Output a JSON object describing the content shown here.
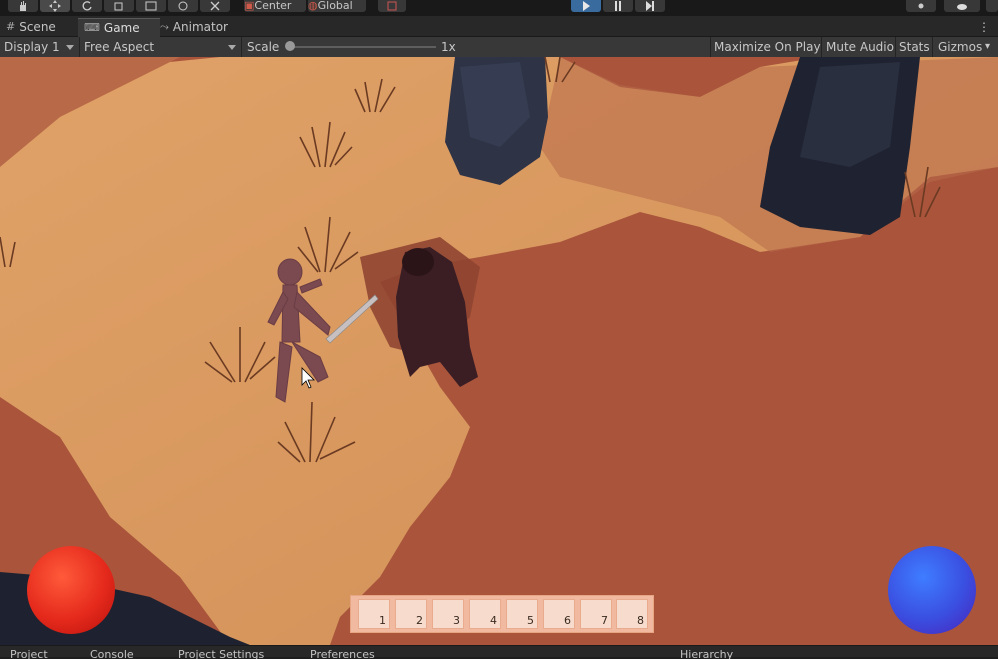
{
  "toolbar": {
    "pivot_label": "Center",
    "space_label": "Global"
  },
  "tabs": [
    {
      "label": "Scene",
      "icon": "grid-icon"
    },
    {
      "label": "Game",
      "icon": "gamepad-icon"
    },
    {
      "label": "Animator",
      "icon": "animator-icon"
    }
  ],
  "game_toolbar": {
    "display": "Display 1",
    "aspect": "Free Aspect",
    "scale_label": "Scale",
    "scale_value": "1x",
    "maximize": "Maximize On Play",
    "mute": "Mute Audio",
    "stats": "Stats",
    "gizmos": "Gizmos"
  },
  "hud": {
    "health_color": "#e52a1c",
    "mana_color": "#3a4ee0",
    "hotbar_slots": [
      "1",
      "2",
      "3",
      "4",
      "5",
      "6",
      "7",
      "8"
    ]
  },
  "bottom_tabs": [
    "Project",
    "Console",
    "Project Settings",
    "Preferences",
    "Hierarchy"
  ]
}
